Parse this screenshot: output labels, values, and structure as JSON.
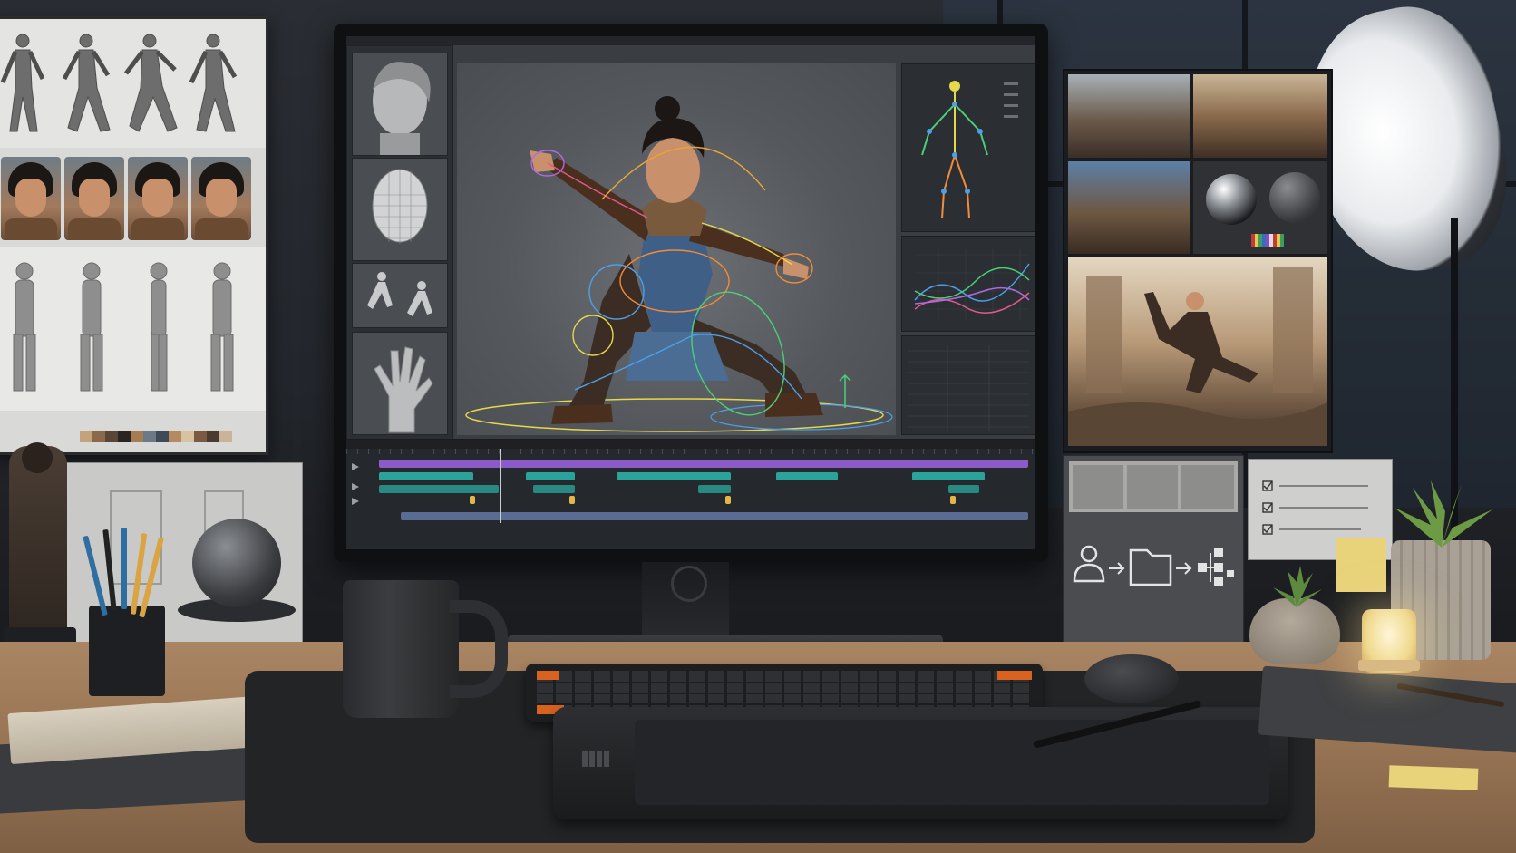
{
  "scene": {
    "description_tag": "",
    "palette": {
      "screen_bg": "#3a3d42",
      "timeline_purple": "#8b5cc7",
      "timeline_teal": "#2aa39a",
      "timeline_yellow": "#e0b84a",
      "rig_yellow": "#e6d84a",
      "rig_green": "#4bd07a",
      "rig_orange": "#f08c3a",
      "rig_blue": "#4ca0e8"
    },
    "icons": [
      "person-icon",
      "folder-icon",
      "node-graph-icon",
      "checkbox-icon"
    ]
  }
}
